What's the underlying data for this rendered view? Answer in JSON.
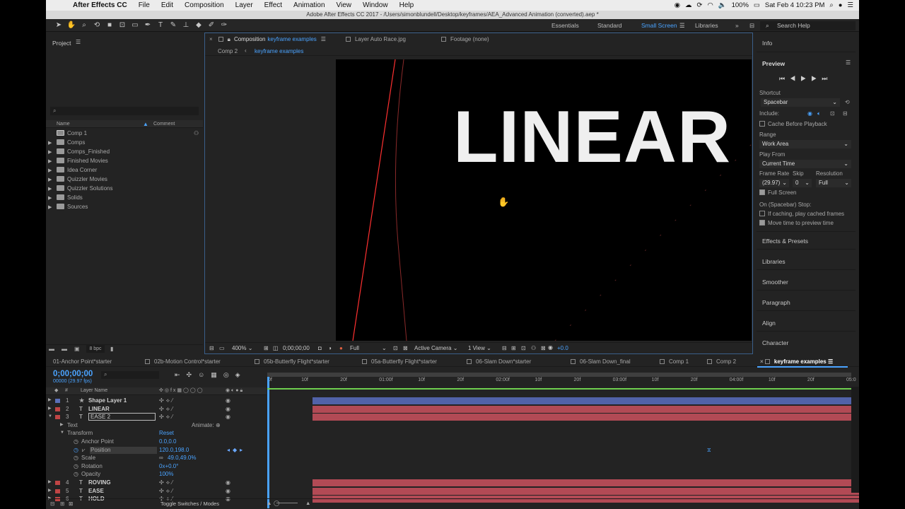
{
  "menubar": {
    "app": "After Effects CC",
    "items": [
      "File",
      "Edit",
      "Composition",
      "Layer",
      "Effect",
      "Animation",
      "View",
      "Window",
      "Help"
    ],
    "battery": "100%",
    "clock": "Sat Feb 4  10:23 PM"
  },
  "window": {
    "title": "Adobe After Effects CC 2017 - /Users/simonblundell/Desktop/keyframes/AEA_Advanced Animation (converted).aep *"
  },
  "workspaces": {
    "items": [
      "Essentials",
      "Standard",
      "Small Screen",
      "Libraries"
    ],
    "active": "Small Screen",
    "search_placeholder": "Search Help"
  },
  "project": {
    "title": "Project",
    "col_name": "Name",
    "col_comment": "Comment",
    "items": [
      {
        "label": "Comp 1",
        "kind": "comp"
      },
      {
        "label": "Comps",
        "kind": "folder"
      },
      {
        "label": "Comps_Finished",
        "kind": "folder"
      },
      {
        "label": "Finished Movies",
        "kind": "folder"
      },
      {
        "label": "Idea Corner",
        "kind": "folder"
      },
      {
        "label": "Quizzler Movies",
        "kind": "folder"
      },
      {
        "label": "Quizzler Solutions",
        "kind": "folder"
      },
      {
        "label": "Solids",
        "kind": "folder"
      },
      {
        "label": "Sources",
        "kind": "folder"
      }
    ],
    "bpc": "8 bpc"
  },
  "viewer": {
    "tab_prefix": "Composition",
    "tab_comp": "keyframe examples",
    "tab_layer": "Layer Auto Race.jpg",
    "tab_footage": "Footage (none)",
    "crumb_parent": "Comp 2",
    "crumb_current": "keyframe examples",
    "canvas_text": "LINEAR",
    "zoom": "400%",
    "timecode": "0;00;00;00",
    "resolution": "Full",
    "camera": "Active Camera",
    "views": "1 View",
    "exposure": "+0.0"
  },
  "right_panel": {
    "info": "Info",
    "preview": "Preview",
    "shortcut_label": "Shortcut",
    "shortcut_value": "Spacebar",
    "include_label": "Include:",
    "cache_label": "Cache Before Playback",
    "range_label": "Range",
    "range_value": "Work Area",
    "play_from_label": "Play From",
    "play_from_value": "Current Time",
    "frame_rate_label": "Frame Rate",
    "skip_label": "Skip",
    "resolution_label": "Resolution",
    "frame_rate_value": "(29.97)",
    "skip_value": "0",
    "resolution_value": "Full",
    "full_screen": "Full Screen",
    "on_stop": "On (Spacebar) Stop:",
    "if_caching": "If caching, play cached frames",
    "move_time": "Move time to preview time",
    "sections": [
      "Effects & Presets",
      "Libraries",
      "Smoother",
      "Paragraph",
      "Align",
      "Character"
    ]
  },
  "timeline": {
    "tabs": [
      "01-Anchor Point*starter",
      "02b-Motion Control*starter",
      "05b-Butterfly Flight*starter",
      "05a-Butterfly Flight*starter",
      "06-Slam Down*starter",
      "06-Slam Down_final",
      "Comp 1",
      "Comp 2",
      "keyframe examples"
    ],
    "active_tab": "keyframe examples",
    "timecode": "0;00;00;00",
    "fps": "00000 (29.97 fps)",
    "layer_name_header": "Layer Name",
    "num_header": "#",
    "ruler": [
      "0f",
      "10f",
      "20f",
      "01:00f",
      "10f",
      "20f",
      "02:00f",
      "10f",
      "20f",
      "03:00f",
      "10f",
      "20f",
      "04:00f",
      "10f",
      "20f",
      "05:0"
    ],
    "layers": [
      {
        "num": "1",
        "type": "★",
        "name": "Shape Layer 1",
        "color": "#5b6fb8"
      },
      {
        "num": "2",
        "type": "T",
        "name": "LINEAR",
        "color": "#c04545"
      },
      {
        "num": "3",
        "type": "T",
        "name": "EASE 2",
        "color": "#c04545"
      }
    ],
    "props": {
      "text": "Text",
      "animate": "Animate:",
      "transform": "Transform",
      "reset": "Reset",
      "anchor_label": "Anchor Point",
      "anchor_value": "0.0,0.0",
      "position_label": "Position",
      "position_value": "120.0,198.0",
      "scale_label": "Scale",
      "scale_value": "49.0,49.0%",
      "rotation_label": "Rotation",
      "rotation_value": "0x+0.0°",
      "opacity_label": "Opacity",
      "opacity_value": "100%"
    },
    "more_layers": [
      {
        "num": "4",
        "type": "T",
        "name": "ROVING",
        "color": "#c04545"
      },
      {
        "num": "5",
        "type": "T",
        "name": "EASE",
        "color": "#c04545"
      },
      {
        "num": "6",
        "type": "T",
        "name": "HOLD",
        "color": "#c04545"
      }
    ],
    "toggle": "Toggle Switches / Modes"
  },
  "colors": {
    "accent": "#4aa3ff",
    "bar_red": "#b24a55",
    "bar_blue": "#5162a8",
    "panel": "#232323"
  }
}
